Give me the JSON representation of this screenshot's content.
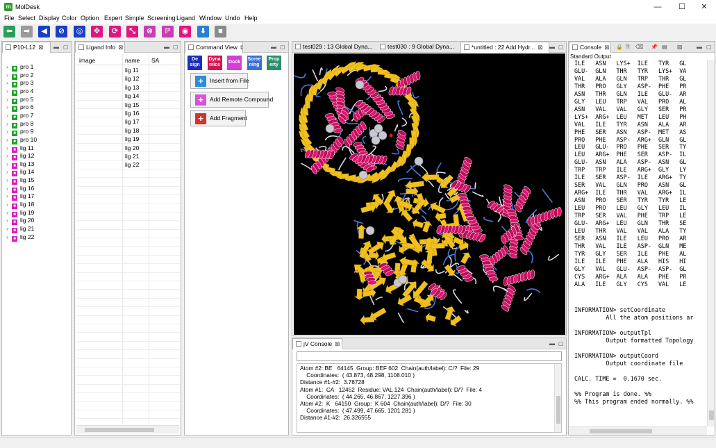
{
  "window": {
    "title": "MolDesk",
    "icon_letter": "m",
    "controls": [
      "—",
      "☐",
      "✕"
    ]
  },
  "menu": [
    "File",
    "Select",
    "Display",
    "Color",
    "Option",
    "Expert",
    "Simple",
    "Screening",
    "Ligand",
    "Window",
    "Undo",
    "Help"
  ],
  "toolbar": {
    "buttons": [
      {
        "icon": "arrow-left-icon",
        "glyph": "⬅",
        "color": "#2a9d5c"
      },
      {
        "icon": "arrow-right-icon",
        "glyph": "➡",
        "color": "#9a9a9a"
      },
      {
        "icon": "back-icon",
        "glyph": "◀",
        "color": "#1a3fc4"
      },
      {
        "icon": "no-entry-icon",
        "glyph": "⊘",
        "color": "#1a3fc4"
      },
      {
        "icon": "target-icon",
        "glyph": "◎",
        "color": "#1a3fc4"
      },
      {
        "icon": "pick-icon",
        "glyph": "✥",
        "color": "#e0157f"
      },
      {
        "icon": "refresh-icon",
        "glyph": "⟳",
        "color": "#e0157f"
      },
      {
        "icon": "shrink-icon",
        "glyph": "⤡",
        "color": "#e0157f"
      },
      {
        "icon": "hide-icon",
        "glyph": "⊗",
        "color": "#c43fb0"
      },
      {
        "icon": "p-icon",
        "glyph": "ℙ",
        "color": "#c43fb0"
      },
      {
        "icon": "eye-icon",
        "glyph": "◉",
        "color": "#e0157f"
      },
      {
        "icon": "download-icon",
        "glyph": "⬇",
        "color": "#2a7fd4"
      },
      {
        "icon": "stop-icon",
        "glyph": "■",
        "color": "#8a8a8a"
      }
    ]
  },
  "tree_panel": {
    "tab": "P10-L12",
    "items": [
      {
        "label": "pro 1",
        "kind": "pro"
      },
      {
        "label": "pro 2",
        "kind": "pro"
      },
      {
        "label": "pro 3",
        "kind": "pro"
      },
      {
        "label": "pro 4",
        "kind": "pro"
      },
      {
        "label": "pro 5",
        "kind": "pro"
      },
      {
        "label": "pro 6",
        "kind": "pro"
      },
      {
        "label": "pro 7",
        "kind": "pro"
      },
      {
        "label": "pro 8",
        "kind": "pro"
      },
      {
        "label": "pro 9",
        "kind": "pro"
      },
      {
        "label": "pro 10",
        "kind": "pro"
      },
      {
        "label": "lig 11",
        "kind": "lig"
      },
      {
        "label": "lig 12",
        "kind": "lig"
      },
      {
        "label": "lig 13",
        "kind": "lig"
      },
      {
        "label": "lig 14",
        "kind": "lig"
      },
      {
        "label": "lig 15",
        "kind": "lig"
      },
      {
        "label": "lig 16",
        "kind": "lig"
      },
      {
        "label": "lig 17",
        "kind": "lig"
      },
      {
        "label": "lig 18",
        "kind": "lig"
      },
      {
        "label": "lig 19",
        "kind": "lig"
      },
      {
        "label": "lig 20",
        "kind": "lig"
      },
      {
        "label": "lig 21",
        "kind": "lig"
      },
      {
        "label": "lig 22",
        "kind": "lig"
      }
    ],
    "colors": {
      "pro": "#1fa32a",
      "lig": "#d620c0"
    }
  },
  "ligand_panel": {
    "tab": "Ligand Info",
    "columns": [
      "image",
      "name",
      "SA"
    ],
    "rows": [
      "lig 11",
      "lig 12",
      "lig 13",
      "lig 14",
      "lig 15",
      "lig 16",
      "lig 17",
      "lig 18",
      "lig 19",
      "lig 20",
      "lig 21",
      "lig 22"
    ]
  },
  "command_panel": {
    "tab": "Command View",
    "mode_icons": [
      {
        "label": "De\nsign",
        "bg": "#1a2fb8",
        "fg": "#ffffff"
      },
      {
        "label": "Dyna\nmics",
        "bg": "#d4164f",
        "fg": "#ffffff"
      },
      {
        "label": "Dock",
        "bg": "#d63fd6",
        "fg": "#ffffff"
      },
      {
        "label": "Scree\nning",
        "bg": "#3a6fd8",
        "fg": "#ffffff"
      },
      {
        "label": "Prop\nerty",
        "bg": "#2a8f6a",
        "fg": "#ffffff"
      }
    ],
    "buttons": [
      {
        "label": "Insert from File",
        "color": "#2a8fd8"
      },
      {
        "label": "Add Remote Compound",
        "color": "#d655d6"
      },
      {
        "label": "Add Fragment",
        "color": "#d83030"
      }
    ]
  },
  "viewer_tabs": [
    {
      "label": "test029 : 13 Global Dyna...",
      "active": false
    },
    {
      "label": "test030 : 9 Global Dyna...",
      "active": false
    },
    {
      "label": "*untitled : 22 Add Hydr...",
      "active": true
    }
  ],
  "jv_console": {
    "tab": "jV Console",
    "input_value": "",
    "lines": [
      "Atom #2: BE   64145  Group: BEF 602  Chain(auth/label): C/?  File: 29",
      "    Coordinates:  ( 43.873, 48.298, 1108.010 )",
      "Distance #1-#2:  3.78728",
      "Atom #1:  CA   12452  Residue: VAL 124  Chain(auth/label): D/?  File: 4",
      "    Coordinates:  ( 44.265, 46.867, 1227.396 )",
      "Atom #2:  K   64150  Group:  K 604  Chain(auth/label): D/?  File: 30",
      "    Coordinates:  ( 47.499, 47.665, 1201.281 )",
      "Distance #1-#2:  26.326555"
    ]
  },
  "console": {
    "tab": "Console",
    "header": "Standard Output",
    "residue_rows": [
      "ILE   ASN   LYS+  ILE   TYR   GL",
      "GLU-  GLN   THR   TYR   LYS+  VA",
      "VAL   ALA   GLN   TRP   THR   GL",
      "THR   PRO   GLY   ASP-  PHE   PR",
      "ASN   THR   GLN   ILE   GLU-  AR",
      "GLY   LEU   TRP   VAL   PRO   AL",
      "ASN   VAL   VAL   GLY   SER   PR",
      "LYS+  ARG+  LEU   MET   LEU   PH",
      "VAL   ILE   TYR   ASN   ALA   AR",
      "PHE   SER   ASN   ASP-  MET   AS",
      "PRO   PHE   ASP-  ARG+  GLN   GL",
      "LEU   GLU-  PRO   PHE   SER   TY",
      "LEU   ARG+  PHE   SER   ASP-  IL",
      "GLU-  ASN   ALA   ASP-  ASN   GL",
      "TRP   TRP   ILE   ARG+  GLY   LY",
      "ILE   SER   ASP-  ILE   ARG+  TY",
      "SER   VAL   GLN   PRO   ASN   GL",
      "ARG+  ILE   THR   VAL   ARG+  IL",
      "ASN   PRO   SER   TYR   TYR   LE",
      "LEU   PRO   LEU   GLY   LEU   IL",
      "TRP   SER   VAL   PHE   TRP   LE",
      "GLU-  ARG+  LEU   GLN   THR   SE",
      "LEU   THR   VAL   VAL   ALA   TY",
      "SER   ASN   ILE   LEU   PRO   AR",
      "THR   VAL   ILE   ASP-  GLN   ME",
      "TYR   GLY   SER   ILE   PHE   AL",
      "ILE   ILE   PHE   ALA   HIS   HI",
      "GLY   VAL   GLU-  ASP-  ASP-  GL",
      "CYS   ARG+  ALA   ALA   PHE   PR",
      "ALA   ILE   GLY   CYS   VAL   LE"
    ],
    "info": [
      {
        "text": "INFORMATION> setCoordinate"
      },
      {
        "text": "         All the atom positions ar"
      },
      {
        "text": ""
      },
      {
        "text": "INFORMATION> outputTpl"
      },
      {
        "text": "         Output formatted Topology"
      },
      {
        "text": ""
      },
      {
        "text": "INFORMATION> outputCoord"
      },
      {
        "text": "         Output coordinate file"
      },
      {
        "text": ""
      },
      {
        "text": "CALC. TIME =  0.1670 sec."
      },
      {
        "text": ""
      },
      {
        "text": "%% Program is done. %%"
      },
      {
        "text": "%% This program ended normally. %%"
      }
    ]
  },
  "colors": {
    "helix": "#e0136f",
    "sheet": "#f0c020",
    "coil": "#d8d8e8",
    "blue_coil": "#4a78d8",
    "atom": "#c8c8d0"
  }
}
